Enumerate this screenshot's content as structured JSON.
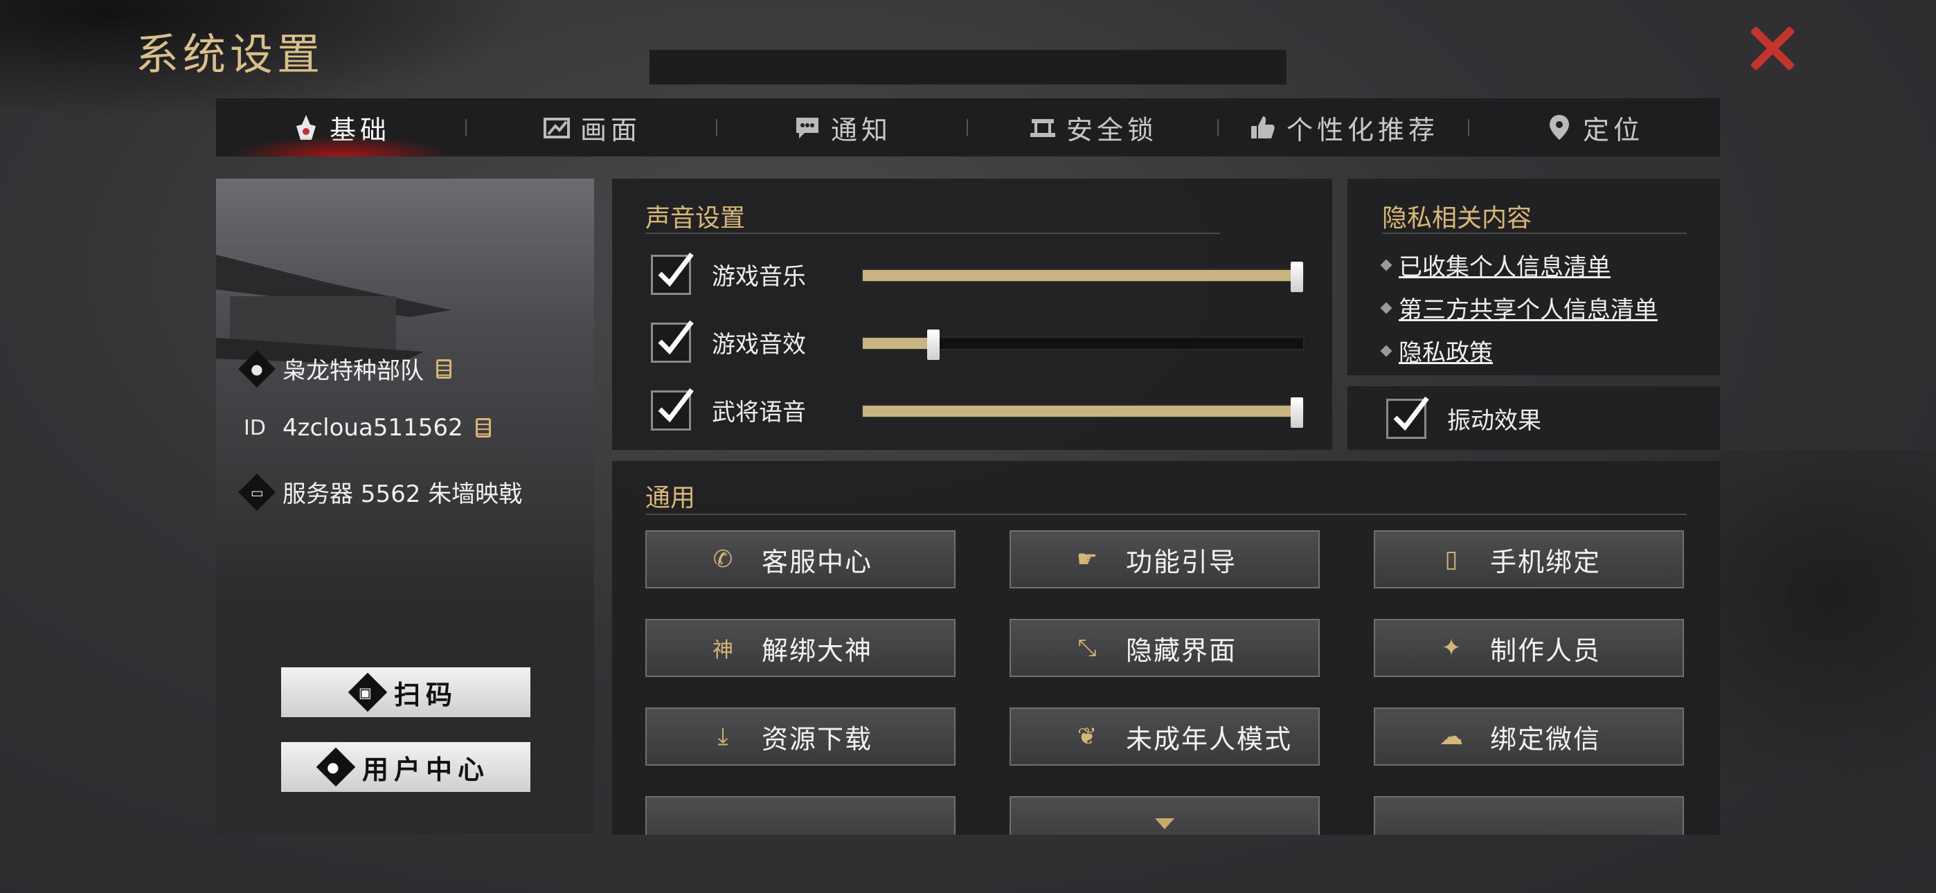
{
  "window": {
    "title": "系统设置"
  },
  "tabs": [
    {
      "label": "基础",
      "icon": "basic-icon",
      "active": true
    },
    {
      "label": "画面",
      "icon": "display-icon",
      "active": false
    },
    {
      "label": "通知",
      "icon": "chat-icon",
      "active": false
    },
    {
      "label": "安全锁",
      "icon": "lock-icon",
      "active": false
    },
    {
      "label": "个性化推荐",
      "icon": "thumbs-up-icon",
      "active": false
    },
    {
      "label": "定位",
      "icon": "location-pin-icon",
      "active": false
    }
  ],
  "profile": {
    "name": "枭龙特种部队",
    "id_badge": "ID",
    "id_value": "4zcloua511562",
    "server": "服务器 5562 朱墙映戟",
    "scan_label": "扫码",
    "user_center_label": "用户中心"
  },
  "sound": {
    "title": "声音设置",
    "items": [
      {
        "label": "游戏音乐",
        "checked": true,
        "level": 1.0
      },
      {
        "label": "游戏音效",
        "checked": true,
        "level": 0.16
      },
      {
        "label": "武将语音",
        "checked": true,
        "level": 1.0
      }
    ]
  },
  "privacy": {
    "title": "隐私相关内容",
    "links": [
      "已收集个人信息清单",
      "第三方共享个人信息清单",
      "隐私政策"
    ]
  },
  "vibration": {
    "label": "振动效果",
    "checked": true
  },
  "general": {
    "title": "通用",
    "buttons": [
      {
        "label": "客服中心",
        "icon": "phone-icon"
      },
      {
        "label": "功能引导",
        "icon": "hand-pointer-icon"
      },
      {
        "label": "手机绑定",
        "icon": "mobile-icon"
      },
      {
        "label": "解绑大神",
        "icon": "shen-icon"
      },
      {
        "label": "隐藏界面",
        "icon": "expand-arrows-icon"
      },
      {
        "label": "制作人员",
        "icon": "credits-icon"
      },
      {
        "label": "资源下载",
        "icon": "download-icon"
      },
      {
        "label": "未成年人模式",
        "icon": "sprout-icon"
      },
      {
        "label": "绑定微信",
        "icon": "wechat-icon"
      }
    ]
  },
  "colors": {
    "accent_gold": "#d7b877",
    "close_red": "#c3342d",
    "slider_fill": "#c9b582"
  }
}
